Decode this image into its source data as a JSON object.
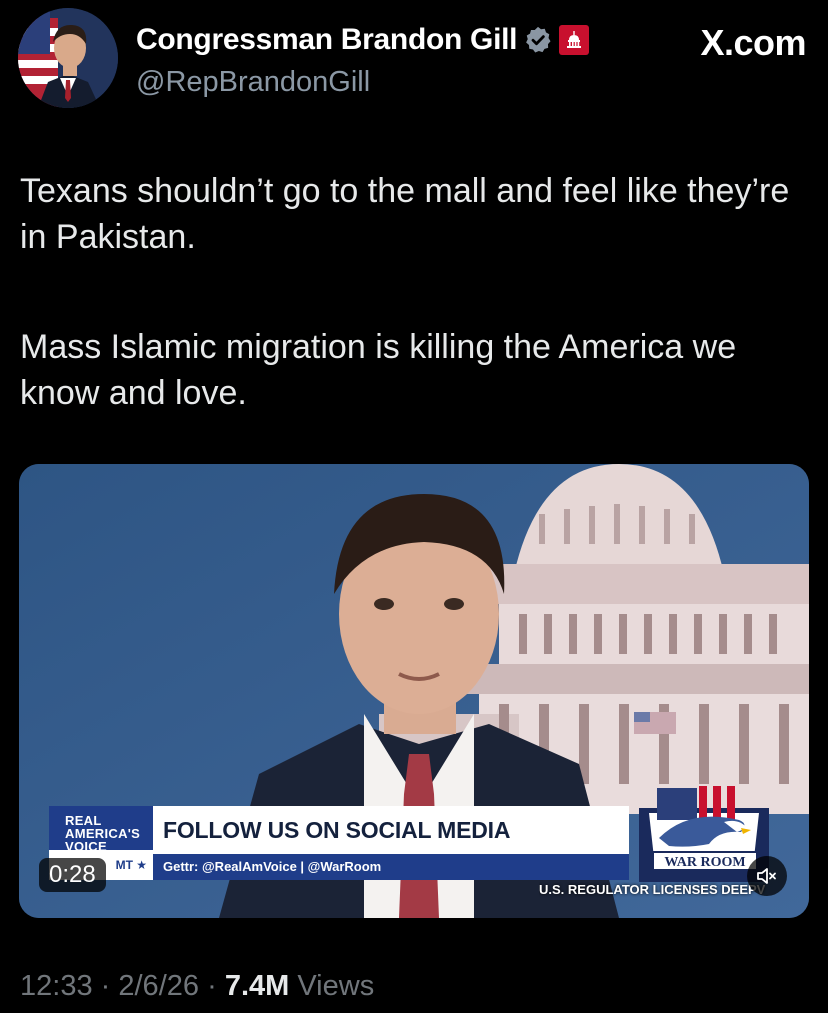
{
  "author": {
    "display_name": "Congressman Brandon Gill",
    "handle": "@RepBrandonGill",
    "verified_badge_color": "#1d9bf0",
    "gov_badge_color": "#c8102e"
  },
  "site_brand": "X.com",
  "tweet": {
    "paragraphs": [
      "Texans shouldn’t go to the mall and feel like they’re in Pakistan.",
      "Mass Islamic migration is killing the America we know and love."
    ]
  },
  "media": {
    "duration": "0:28",
    "lower_third": {
      "logo_line1": "REAL",
      "logo_line2": "AMERICA'S",
      "logo_line3": "VOICE",
      "logo_strip": "MT ★",
      "headline": "FOLLOW US ON SOCIAL MEDIA",
      "social_handles": "Gettr: @RealAmVoice | @WarRoom",
      "brand_logo": "WAR ROOM"
    },
    "ticker": "U.S. REGULATOR LICENSES DEEPV"
  },
  "meta": {
    "time": "12:33",
    "date": "2/6/26",
    "separator": "·",
    "views_count": "7.4M",
    "views_label": "Views"
  },
  "icons": {
    "verified": "verified-badge-icon",
    "government": "capitol-icon",
    "mute": "speaker-muted-icon"
  }
}
